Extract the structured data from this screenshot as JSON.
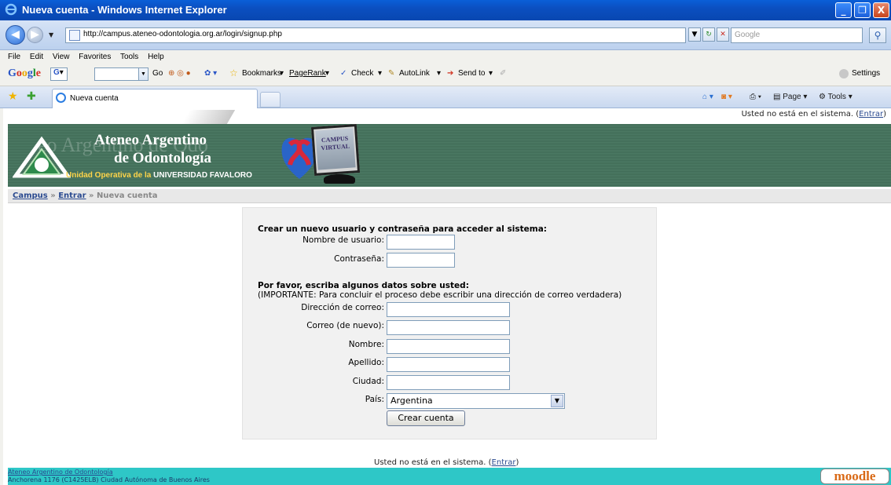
{
  "window": {
    "title": "Nueva cuenta - Windows Internet Explorer",
    "minimize": "_",
    "restore": "❐",
    "close": "X"
  },
  "addressbar": {
    "url": "http://campus.ateneo-odontologia.org.ar/login/signup.php",
    "search_placeholder": "Google"
  },
  "menu": [
    "File",
    "Edit",
    "View",
    "Favorites",
    "Tools",
    "Help"
  ],
  "google_toolbar": {
    "go": "Go",
    "bookmarks": "Bookmarks",
    "pagerank": "PageRank",
    "check": "Check",
    "autolink": "AutoLink",
    "sendto": "Send to",
    "settings": "Settings"
  },
  "tab": {
    "label": "Nueva cuenta"
  },
  "command_bar": {
    "page": "Page",
    "tools": "Tools"
  },
  "page": {
    "login_status": "Usted no está en el sistema.",
    "login_link": "Entrar",
    "banner": {
      "line1": "Ateneo Argentino",
      "line2": "de Odontología",
      "unit": "Unidad Operativa de la",
      "university": "UNIVERSIDAD FAVALORO",
      "campus1": "CAMPUS",
      "campus2": "VIRTUAL"
    },
    "breadcrumb": {
      "campus": "Campus",
      "entrar": "Entrar",
      "current": "Nueva cuenta",
      "sep": "»"
    },
    "form": {
      "heading1": "Crear un nuevo usuario y contraseña para acceder al sistema:",
      "username_label": "Nombre de usuario:",
      "password_label": "Contraseña:",
      "heading2": "Por favor, escriba algunos datos sobre usted:",
      "important": "(IMPORTANTE: Para concluir el proceso debe escribir una dirección de correo verdadera)",
      "email_label": "Dirección de correo:",
      "email2_label": "Correo (de nuevo):",
      "firstname_label": "Nombre:",
      "lastname_label": "Apellido:",
      "city_label": "Ciudad:",
      "country_label": "País:",
      "country_value": "Argentina",
      "submit": "Crear cuenta"
    },
    "footer": {
      "status": "Usted no está en el sistema.",
      "status_link": "Entrar",
      "org": "Ateneo Argentino de Odontología",
      "address": "Anchorena 1176 (C1425ELB) Ciudad Autónoma de Buenos Aires",
      "moodle": "moodle"
    }
  }
}
